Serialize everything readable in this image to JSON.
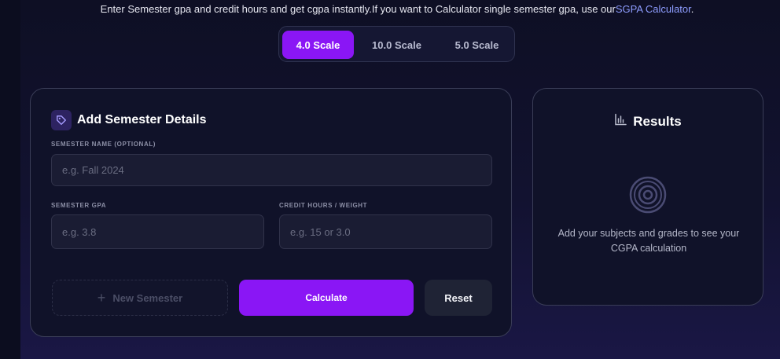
{
  "intro": {
    "text": "Enter Semester gpa and credit hours and get cgpa instantly.If you want to Calculator single semester gpa, use our",
    "link": "SGPA Calculator",
    "suffix": "."
  },
  "scales": [
    {
      "label": "4.0 Scale",
      "active": true
    },
    {
      "label": "10.0 Scale",
      "active": false
    },
    {
      "label": "5.0 Scale",
      "active": false
    }
  ],
  "form": {
    "title": "Add Semester Details",
    "title_icon": "tag-icon",
    "semester_name": {
      "label": "SEMESTER NAME (OPTIONAL)",
      "placeholder": "e.g. Fall 2024",
      "value": ""
    },
    "semester_gpa": {
      "label": "SEMESTER GPA",
      "placeholder": "e.g. 3.8",
      "value": ""
    },
    "credit_hours": {
      "label": "CREDIT HOURS / WEIGHT",
      "placeholder": "e.g. 15 or 3.0",
      "value": ""
    },
    "new_semester_label": "New Semester",
    "calculate_label": "Calculate",
    "reset_label": "Reset"
  },
  "results": {
    "title": "Results",
    "title_icon": "bar-chart-icon",
    "empty_icon": "target-icon",
    "message": "Add your subjects and grades to see your CGPA calculation"
  },
  "colors": {
    "accent": "#8a16f5",
    "link": "#8e9dff",
    "card_bg": "#101229",
    "page_bg": "#0c0d1f"
  }
}
